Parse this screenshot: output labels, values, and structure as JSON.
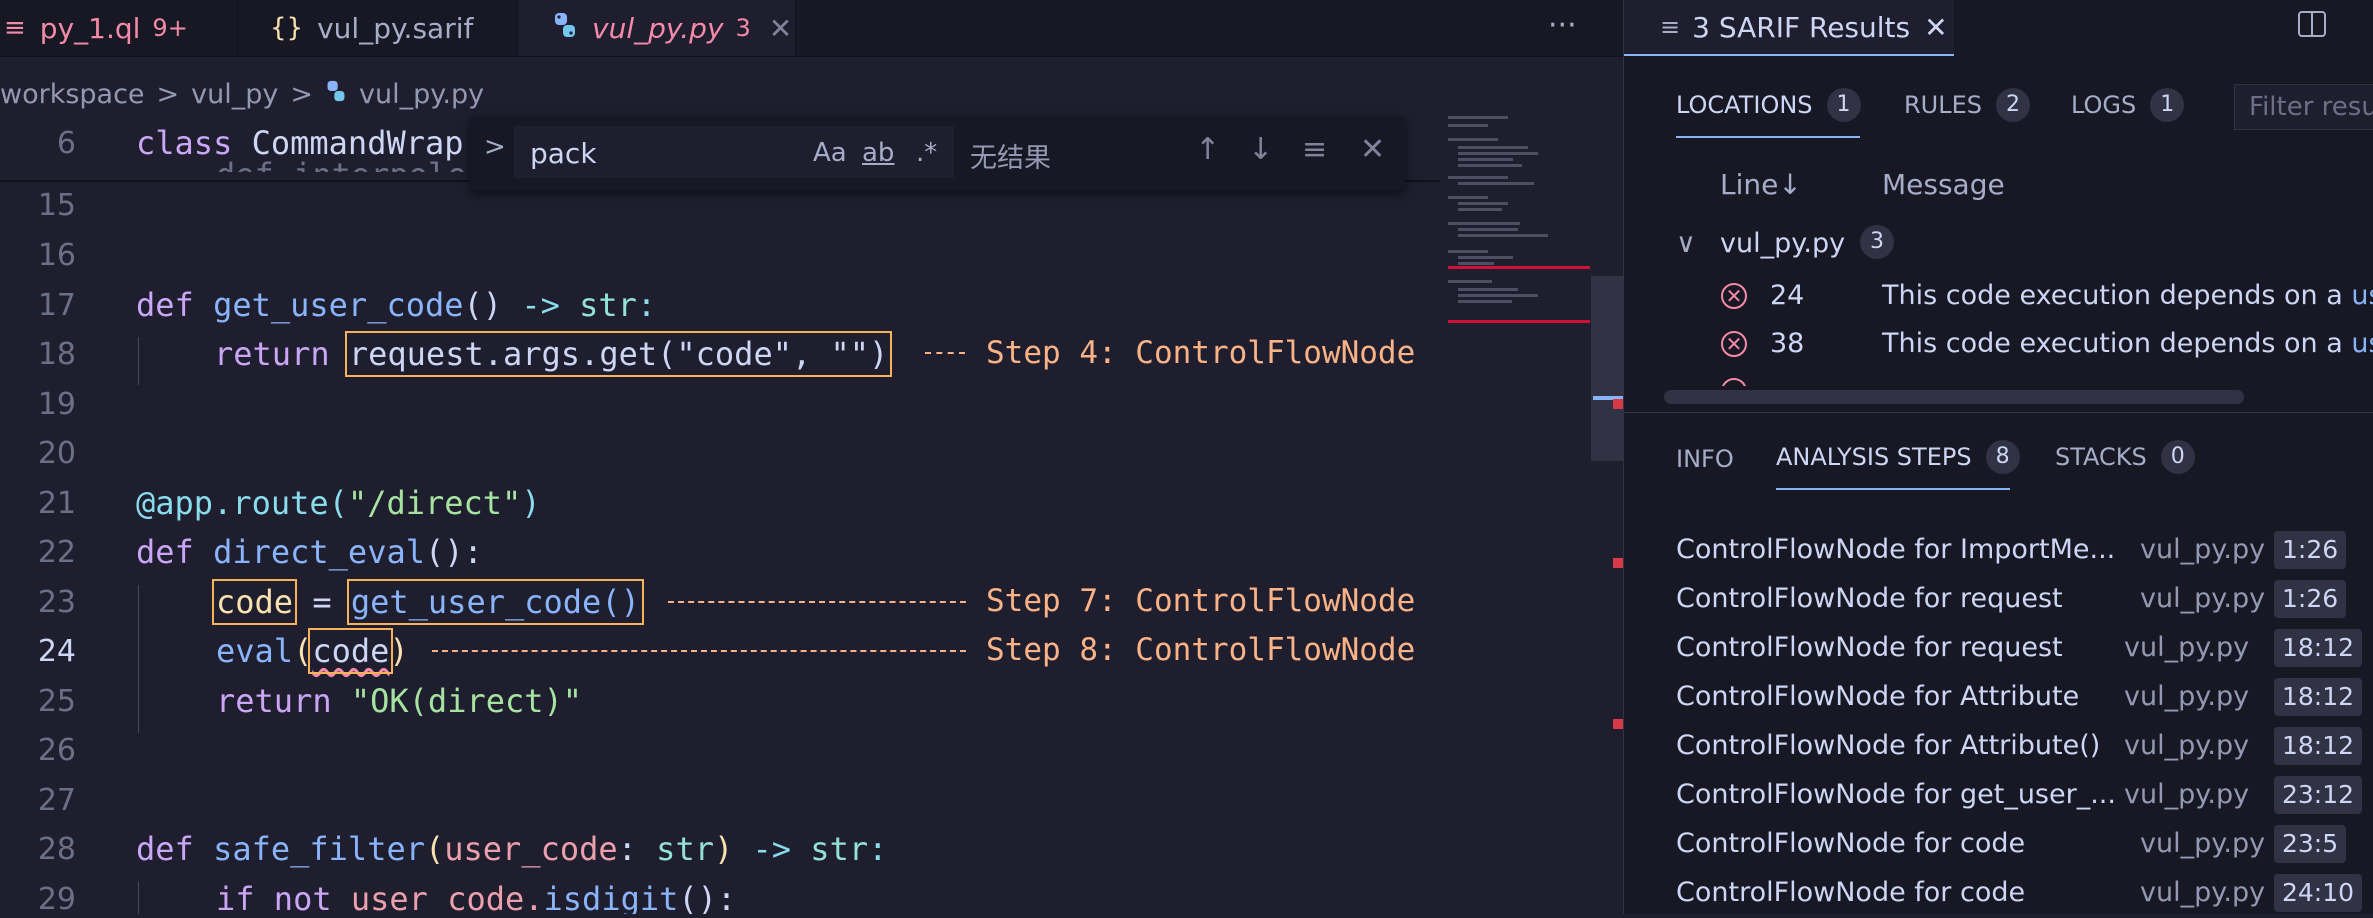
{
  "tabs": [
    {
      "icon": "≡",
      "label": "py_1.ql",
      "count": "9+"
    },
    {
      "icon": "{}",
      "label": "vul_py.sarif"
    },
    {
      "icon": "py",
      "label": "vul_py.py",
      "count": "3"
    }
  ],
  "tab_more": "···",
  "breadcrumb": {
    "part1": "workspace",
    "part2": "vul_py",
    "part3": "vul_py.py",
    "sep": ">"
  },
  "find": {
    "query": "pack",
    "opt_case": "Aa",
    "opt_word": "ab",
    "opt_regex": ".*",
    "no_result": "无结果",
    "prev": "↑",
    "next": "↓",
    "selection": "≡",
    "close": "✕",
    "toggle": ">"
  },
  "editor": {
    "lines": [
      {
        "n": "6"
      },
      {
        "n": "15"
      },
      {
        "n": "16"
      },
      {
        "n": "17"
      },
      {
        "n": "18"
      },
      {
        "n": "19"
      },
      {
        "n": "20"
      },
      {
        "n": "21"
      },
      {
        "n": "22"
      },
      {
        "n": "23"
      },
      {
        "n": "24"
      },
      {
        "n": "25"
      },
      {
        "n": "26"
      },
      {
        "n": "27"
      },
      {
        "n": "28"
      },
      {
        "n": "29"
      }
    ],
    "l6": {
      "kw": "class",
      "name": "CommandWrap",
      "under": "def interpole"
    },
    "l17": {
      "kw": "def",
      "fn": "get_user_code",
      "punc": "()",
      "arrow": "->",
      "ty": "str",
      "colon": ":"
    },
    "l18": {
      "kw": "return",
      "hl": "request.args.get(\"code\", \"\")"
    },
    "l21": {
      "dec": "@app.route(",
      "str": "\"/direct\"",
      "close": ")"
    },
    "l22": {
      "kw": "def",
      "fn": "direct_eval",
      "punc": "():"
    },
    "l23": {
      "var": "code",
      "eq": " = ",
      "call": "get_user_code()"
    },
    "l24": {
      "fn": "eval",
      "open": "(",
      "var": "code",
      "close": ")"
    },
    "l25": {
      "kw": "return",
      "str": "\"OK(direct)\""
    },
    "l28": {
      "kw": "def",
      "fn": "safe_filter",
      "open": "(",
      "param": "user_code",
      "colon": ": ",
      "ty": "str",
      "close": ")",
      "arrow": "->",
      "ty2": "str",
      "end": ":"
    },
    "l29": {
      "kw": "if not",
      "rest": "user_code.",
      "fn": "isdigit",
      "end": "():"
    },
    "steps": {
      "s4": "Step 4: ControlFlowNode",
      "s7": "Step 7: ControlFlowNode",
      "s8": "Step 8: ControlFlowNode"
    }
  },
  "panel": {
    "title": "3 SARIF Results",
    "title_icon": "≡",
    "close": "✕",
    "top_tabs": [
      {
        "label": "LOCATIONS",
        "count": "1"
      },
      {
        "label": "RULES",
        "count": "2"
      },
      {
        "label": "LOGS",
        "count": "1"
      }
    ],
    "filter_placeholder": "Filter result",
    "columns": {
      "line": "Line",
      "sort": "↓",
      "message": "Message"
    },
    "group": {
      "chevron": "∨",
      "file": "vul_py.py",
      "count": "3"
    },
    "results": [
      {
        "line": "24",
        "message": "This code execution depends on a ",
        "link": "use"
      },
      {
        "line": "38",
        "message": "This code execution depends on a ",
        "link": "use"
      }
    ],
    "bottom_tabs": [
      {
        "label": "INFO"
      },
      {
        "label": "ANALYSIS STEPS",
        "count": "8"
      },
      {
        "label": "STACKS",
        "count": "0"
      }
    ],
    "steps": [
      {
        "message": "ControlFlowNode for ImportMe...",
        "file": "vul_py.py",
        "pos": "1:26"
      },
      {
        "message": "ControlFlowNode for request",
        "file": "vul_py.py",
        "pos": "1:26"
      },
      {
        "message": "ControlFlowNode for request",
        "file": "vul_py.py",
        "pos": "18:12"
      },
      {
        "message": "ControlFlowNode for Attribute",
        "file": "vul_py.py",
        "pos": "18:12"
      },
      {
        "message": "ControlFlowNode for Attribute()",
        "file": "vul_py.py",
        "pos": "18:12"
      },
      {
        "message": "ControlFlowNode for get_user_...",
        "file": "vul_py.py",
        "pos": "23:12"
      },
      {
        "message": "ControlFlowNode for code",
        "file": "vul_py.py",
        "pos": "23:5"
      },
      {
        "message": "ControlFlowNode for code",
        "file": "vul_py.py",
        "pos": "24:10"
      }
    ]
  }
}
